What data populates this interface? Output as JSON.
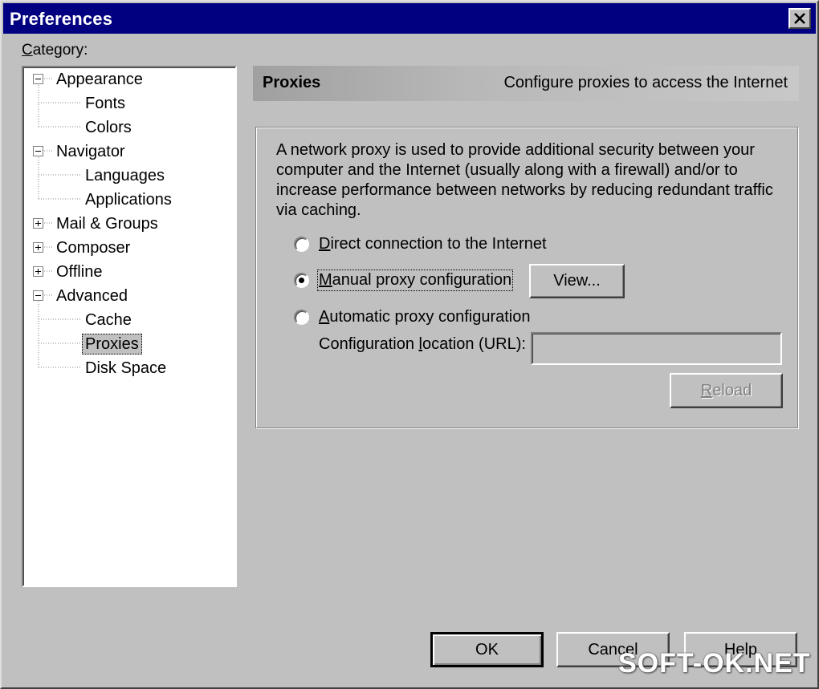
{
  "window": {
    "title": "Preferences"
  },
  "category": {
    "label_prefix": "C",
    "label_rest": "ategory:"
  },
  "tree": {
    "items": [
      {
        "label": "Appearance",
        "level": 0,
        "expander": "minus"
      },
      {
        "label": "Fonts",
        "level": 1
      },
      {
        "label": "Colors",
        "level": 1
      },
      {
        "label": "Navigator",
        "level": 0,
        "expander": "minus"
      },
      {
        "label": "Languages",
        "level": 1
      },
      {
        "label": "Applications",
        "level": 1
      },
      {
        "label": "Mail & Groups",
        "level": 0,
        "expander": "plus"
      },
      {
        "label": "Composer",
        "level": 0,
        "expander": "plus"
      },
      {
        "label": "Offline",
        "level": 0,
        "expander": "plus"
      },
      {
        "label": "Advanced",
        "level": 0,
        "expander": "minus"
      },
      {
        "label": "Cache",
        "level": 1
      },
      {
        "label": "Proxies",
        "level": 1,
        "selected": true
      },
      {
        "label": "Disk Space",
        "level": 1
      }
    ]
  },
  "header": {
    "title": "Proxies",
    "description": "Configure proxies to access the Internet"
  },
  "proxy": {
    "description": "A network proxy is used to provide additional security between your computer and the Internet (usually along with a firewall) and/or to increase performance between networks by reducing redundant traffic via caching.",
    "direct": {
      "mnemonic": "D",
      "rest": "irect connection to the Internet",
      "checked": false
    },
    "manual": {
      "mnemonic": "M",
      "rest": "anual proxy configuration",
      "checked": true
    },
    "automatic": {
      "mnemonic": "A",
      "rest": "utomatic proxy configuration",
      "checked": false
    },
    "view_button": "View...",
    "url_label_pre": "Configuration ",
    "url_label_mnemonic": "l",
    "url_label_post": "ocation (URL):",
    "url_value": "",
    "reload_mnemonic": "R",
    "reload_rest": "eload"
  },
  "buttons": {
    "ok": "OK",
    "cancel": "Cancel",
    "help": "Help"
  },
  "watermark": "SOFT-OK.NET"
}
